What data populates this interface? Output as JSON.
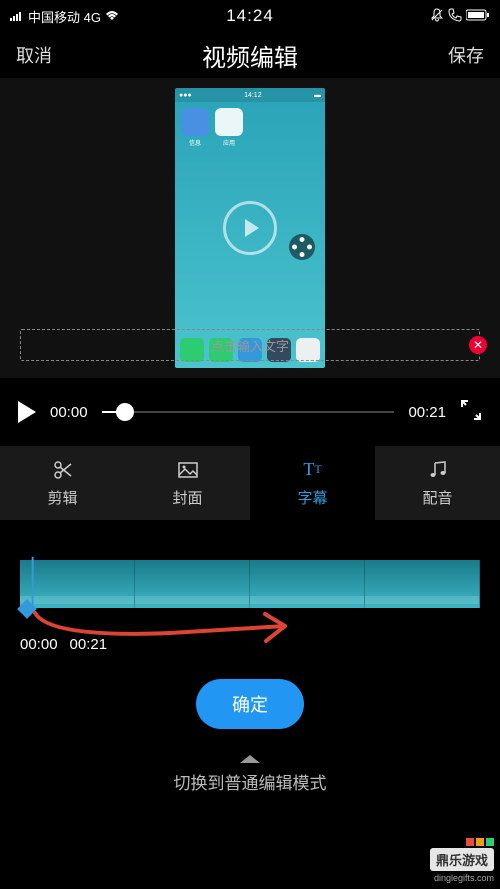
{
  "status": {
    "carrier": "中国移动 4G",
    "time": "14:24"
  },
  "header": {
    "cancel": "取消",
    "title": "视频编辑",
    "save": "保存"
  },
  "subtitle_input": {
    "placeholder": "点击输入文字"
  },
  "player": {
    "current": "00:00",
    "duration": "00:21"
  },
  "tabs": {
    "trim": "剪辑",
    "cover": "封面",
    "subtitle": "字幕",
    "music": "配音"
  },
  "timeline": {
    "start": "00:00",
    "end": "00:21"
  },
  "confirm": "确定",
  "switch_mode": "切换到普通编辑模式",
  "watermark": {
    "name": "鼎乐游戏",
    "url": "dinglegifts.com"
  },
  "colors": {
    "accent": "#3498db",
    "annotation": "#d43030"
  }
}
